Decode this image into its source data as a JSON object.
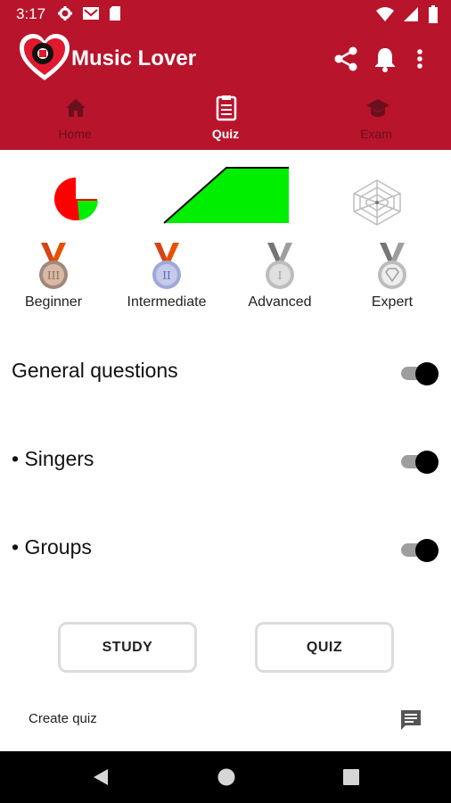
{
  "status_bar": {
    "time": "3:17",
    "left_icons": [
      "settings-icon",
      "gmail-icon",
      "sd-card-icon"
    ],
    "right_icons": [
      "wifi-icon",
      "signal-icon",
      "battery-icon"
    ]
  },
  "app_bar": {
    "title": "Music Lover",
    "actions": [
      "share-icon",
      "bell-icon",
      "overflow-menu-icon"
    ],
    "colors": {
      "primary": "#b8142c",
      "text": "#ffffff"
    }
  },
  "tabs": [
    {
      "label": "Home",
      "icon": "home-icon",
      "active": false
    },
    {
      "label": "Quiz",
      "icon": "clipboard-icon",
      "active": true
    },
    {
      "label": "Exam",
      "icon": "graduation-cap-icon",
      "active": false
    }
  ],
  "stats": {
    "pie_colors": {
      "primary": "#ff0000",
      "accent": "#00ee00"
    },
    "area_color": "#00ee00",
    "radar_icon": "radar-chart-icon"
  },
  "levels": [
    {
      "label": "Beginner",
      "icon": "medal-bronze-icon",
      "ribbon": "#d84315"
    },
    {
      "label": "Intermediate",
      "icon": "medal-bronze-blue-icon",
      "ribbon": "#d84315"
    },
    {
      "label": "Advanced",
      "icon": "medal-silver-icon",
      "ribbon": "#8a8a8a"
    },
    {
      "label": "Expert",
      "icon": "medal-silver-diamond-icon",
      "ribbon": "#8a8a8a"
    }
  ],
  "topics": [
    {
      "label": "General questions",
      "enabled": true
    },
    {
      "label": "• Singers",
      "enabled": true
    },
    {
      "label": "• Groups",
      "enabled": true
    }
  ],
  "buttons": {
    "study": "STUDY",
    "quiz": "QUIZ"
  },
  "footer": {
    "create_quiz": "Create quiz",
    "chat_icon": "chat-icon"
  },
  "nav_bar": {
    "back": "back-icon",
    "home": "home-circle-icon",
    "recents": "recents-icon"
  }
}
